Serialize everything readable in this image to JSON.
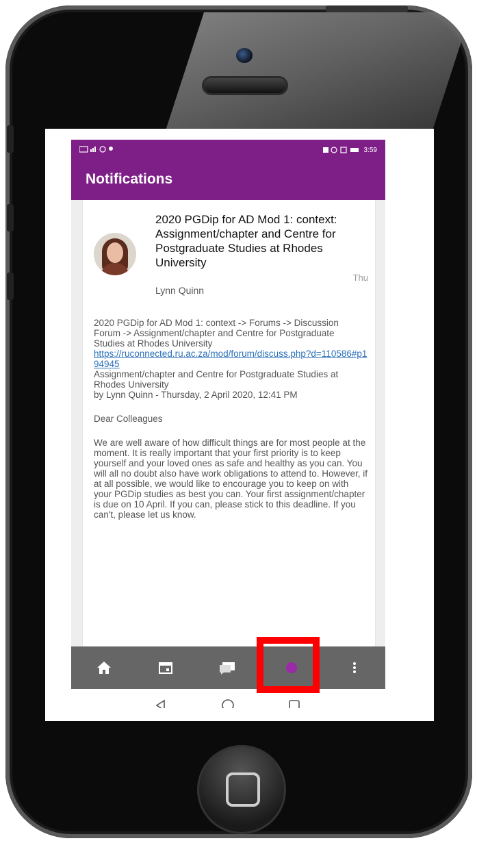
{
  "status": {
    "left_icons": "mail, signal, whatsapp, location",
    "right_text": "3:59"
  },
  "header": {
    "title": "Notifications"
  },
  "notification": {
    "title": "2020 PGDip for AD Mod 1: context: Assignment/chapter and Centre for Postgraduate Studies at Rhodes University",
    "time": "Thu",
    "author": "Lynn Quinn",
    "body": [
      "2020 PGDip for AD Mod 1: context -> Forums -> Discussion Forum -> Assignment/chapter and Centre for Postgraduate Studies at Rhodes University",
      "https://ruconnected.ru.ac.za/mod/forum/discuss.php?d=110586#p194945",
      "Assignment/chapter and Centre for Postgraduate Studies at Rhodes University",
      "by Lynn Quinn - Thursday, 2 April 2020, 12:41 PM",
      "Dear Colleagues",
      "We are well aware of how difficult things are for most people at the moment. It is really important that your first priority is to keep yourself and your loved ones as safe and healthy as you can. You will all no doubt also have work obligations to attend to. However, if at all possible, we would like to encourage you to keep on with your PGDip studies as best you can. Your first assignment/chapter is due on 10 April. If you can, please stick to this deadline. If you can't, please let us know."
    ]
  },
  "bottom_nav": {
    "items": [
      "home-icon",
      "calendar-icon",
      "messages-icon",
      "notifications-icon",
      "more-icon"
    ]
  },
  "system_nav": {
    "items": [
      "back-icon",
      "home-circle-icon",
      "recents-icon"
    ]
  },
  "colors": {
    "brand": "#7d1f86",
    "nav_bg": "#666666",
    "link": "#2a6fb9",
    "highlight": "#ff0000"
  }
}
